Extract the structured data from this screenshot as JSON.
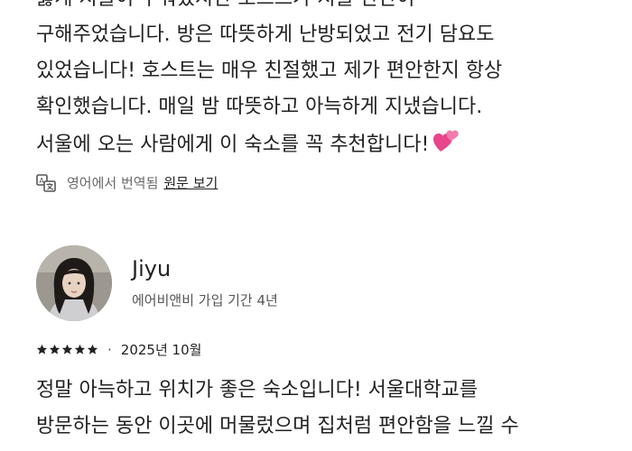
{
  "review_prev": {
    "lines": [
      "듫게 지불이 무워졌지만 호스트가 지불 판단이",
      "구해주었습니다. 방은 따뜻하게 난방되었고 전기 담요도",
      "있었습니다! 호스트는 매우 친절했고 제가 편안한지 항상",
      "확인했습니다. 매일 밤 따뜻하고 아늑하게 지냈습니다.",
      "서울에 오는 사람에게 이 숙소를 꼭 추천합니다!"
    ],
    "emoji_icon": "two-hearts-icon"
  },
  "translation": {
    "text": "영어에서 번역됨",
    "link": "원문 보기",
    "icon": "translate-icon"
  },
  "reviewer": {
    "name": "Jiyu",
    "meta": "에어비앤비 가입 기간 4년",
    "avatar_icon": "avatar"
  },
  "review": {
    "rating": 5,
    "date": "2025년 10월",
    "lines": [
      "정말 아늑하고 위치가 좋은 숙소입니다! 서울대학교를",
      "방문하는 동안 이곳에 머물렀으며 집처럼 편안함을 느낄 수"
    ]
  },
  "colors": {
    "text": "#222222",
    "muted": "#6a6a6a",
    "heart": "#e8458b"
  }
}
